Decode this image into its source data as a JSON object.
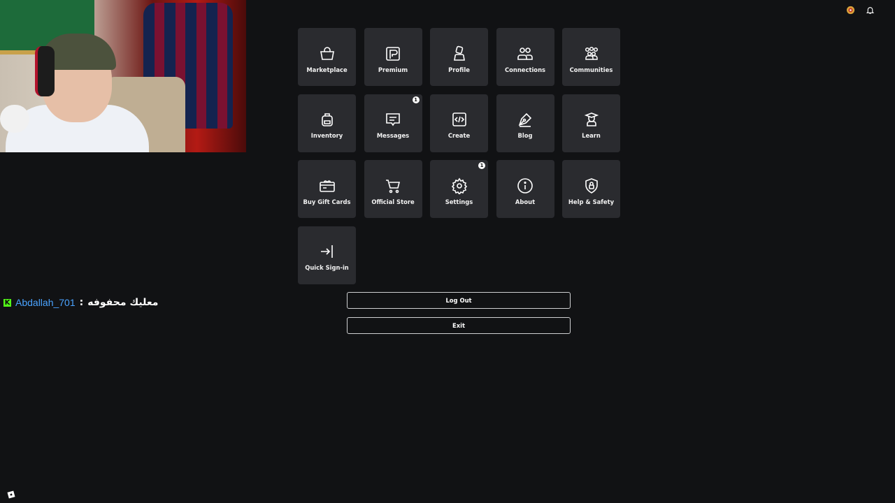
{
  "top_icons": [
    "robux-icon",
    "bell-icon"
  ],
  "menu": [
    {
      "id": "marketplace",
      "label": "Marketplace",
      "icon": "shopping-bag-icon",
      "badge": ""
    },
    {
      "id": "premium",
      "label": "Premium",
      "icon": "premium-icon",
      "badge": ""
    },
    {
      "id": "profile",
      "label": "Profile",
      "icon": "person-icon",
      "badge": ""
    },
    {
      "id": "connections",
      "label": "Connections",
      "icon": "people-icon",
      "badge": ""
    },
    {
      "id": "communities",
      "label": "Communities",
      "icon": "group-icon",
      "badge": ""
    },
    {
      "id": "inventory",
      "label": "Inventory",
      "icon": "backpack-icon",
      "badge": ""
    },
    {
      "id": "messages",
      "label": "Messages",
      "icon": "message-icon",
      "badge": "1"
    },
    {
      "id": "create",
      "label": "Create",
      "icon": "code-icon",
      "badge": ""
    },
    {
      "id": "blog",
      "label": "Blog",
      "icon": "pen-nib-icon",
      "badge": ""
    },
    {
      "id": "learn",
      "label": "Learn",
      "icon": "graduation-icon",
      "badge": ""
    },
    {
      "id": "buy-gift-cards",
      "label": "Buy Gift Cards",
      "icon": "gift-card-icon",
      "badge": ""
    },
    {
      "id": "official-store",
      "label": "Official Store",
      "icon": "cart-icon",
      "badge": ""
    },
    {
      "id": "settings",
      "label": "Settings",
      "icon": "gear-icon",
      "badge": "1"
    },
    {
      "id": "about",
      "label": "About",
      "icon": "info-icon",
      "badge": ""
    },
    {
      "id": "help-safety",
      "label": "Help & Safety",
      "icon": "shield-lock-icon",
      "badge": ""
    },
    {
      "id": "quick-sign-in",
      "label": "Quick Sign-in",
      "icon": "sign-in-icon",
      "badge": ""
    }
  ],
  "buttons": {
    "logout": "Log Out",
    "exit": "Exit"
  },
  "chat": {
    "platform_icon": "K",
    "username": "Abdallah_701",
    "separator": ":",
    "message": "معليك محفوفه"
  },
  "colors": {
    "background": "#111214",
    "tile": "#2a2b2f",
    "chat_username": "#4aa3ff",
    "kick_green": "#53fc18"
  }
}
